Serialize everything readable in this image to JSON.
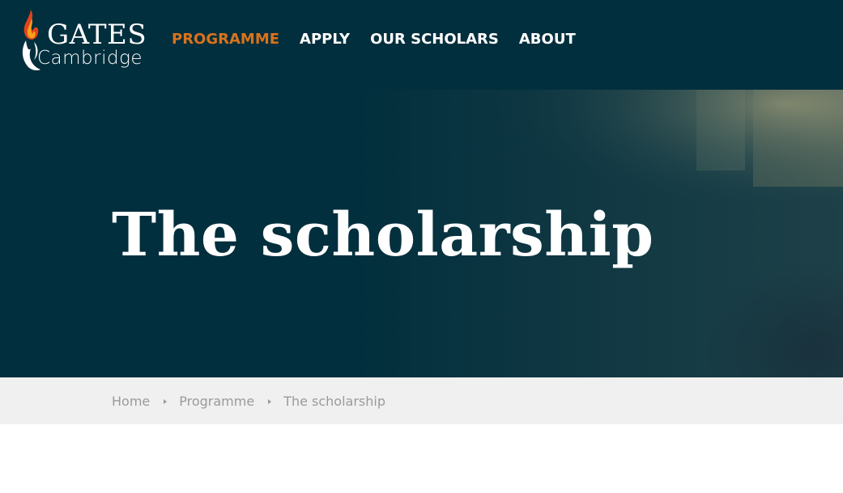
{
  "header": {
    "logo": {
      "line1": "GATES",
      "line2": "Cambridge"
    },
    "nav": [
      {
        "label": "PROGRAMME",
        "active": true
      },
      {
        "label": "APPLY",
        "active": false
      },
      {
        "label": "OUR SCHOLARS",
        "active": false
      },
      {
        "label": "ABOUT",
        "active": false
      }
    ]
  },
  "hero": {
    "title": "The scholarship"
  },
  "breadcrumb": {
    "items": [
      "Home",
      "Programme",
      "The scholarship"
    ]
  },
  "colors": {
    "header_bg": "#022f3d",
    "accent": "#d9731c",
    "breadcrumb_bg": "#f0f0f0",
    "breadcrumb_text": "#9a9a9a"
  }
}
